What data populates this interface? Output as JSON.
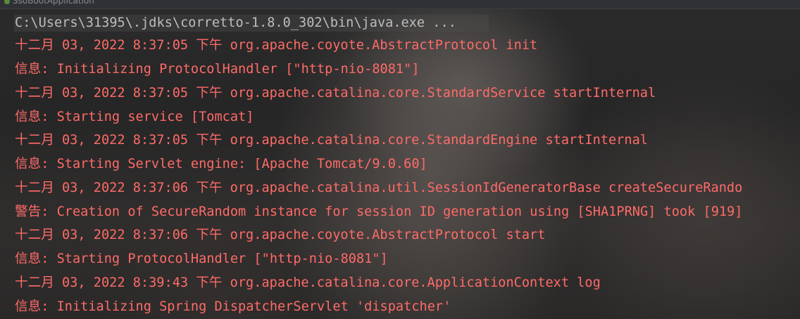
{
  "tab": {
    "label": "SsoBootApplication"
  },
  "console": {
    "command": "C:\\Users\\31395\\.jdks\\corretto-1.8.0_302\\bin\\java.exe ...",
    "lines": [
      "十二月 03, 2022 8:37:05 下午 org.apache.coyote.AbstractProtocol init",
      "信息: Initializing ProtocolHandler [\"http-nio-8081\"]",
      "十二月 03, 2022 8:37:05 下午 org.apache.catalina.core.StandardService startInternal",
      "信息: Starting service [Tomcat]",
      "十二月 03, 2022 8:37:05 下午 org.apache.catalina.core.StandardEngine startInternal",
      "信息: Starting Servlet engine: [Apache Tomcat/9.0.60]",
      "十二月 03, 2022 8:37:06 下午 org.apache.catalina.util.SessionIdGeneratorBase createSecureRando",
      "警告: Creation of SecureRandom instance for session ID generation using [SHA1PRNG] took [919]",
      "十二月 03, 2022 8:37:06 下午 org.apache.coyote.AbstractProtocol start",
      "信息: Starting ProtocolHandler [\"http-nio-8081\"]",
      "十二月 03, 2022 8:39:43 下午 org.apache.catalina.core.ApplicationContext log",
      "信息: Initializing Spring DispatcherServlet 'dispatcher'"
    ]
  },
  "colors": {
    "log_text": "#ff6b68",
    "command_text": "#bdbdbd",
    "background": "#262626"
  }
}
